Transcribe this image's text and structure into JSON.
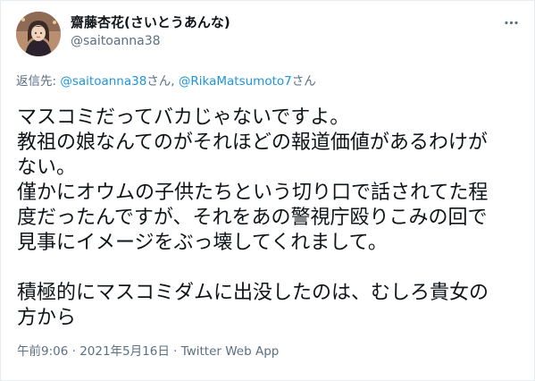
{
  "tweet": {
    "author": {
      "display_name": "齋藤杏花(さいとうあんな)",
      "handle": "@saitoanna38"
    },
    "reply": {
      "prefix": "返信先: ",
      "mentions": [
        "@saitoanna38",
        "@RikaMatsumoto7"
      ],
      "separator": "さん, ",
      "suffix": "さん"
    },
    "text_lines": [
      "マスコミだってバカじゃないですよ。",
      "教祖の娘なんてのがそれほどの報道価値があるわけが",
      "ない。",
      "僅かにオウムの子供たちという切り口で話されてた程",
      "度だったんですが、それをあの警視庁殴りこみの回で",
      "見事にイメージをぶっ壊してくれまして。",
      "",
      "積極的にマスコミダムに出没したのは、むしろ貴女の",
      "方から"
    ],
    "meta": {
      "time": "午前9:06",
      "separator": " · ",
      "date": "2021年5月16日",
      "source": "Twitter Web App"
    }
  },
  "icons": {
    "more": "more-horizontal-icon"
  },
  "colors": {
    "text": "#0f1419",
    "secondary": "#5b7083",
    "link": "#1b95e0",
    "border": "#e6ecf0"
  }
}
